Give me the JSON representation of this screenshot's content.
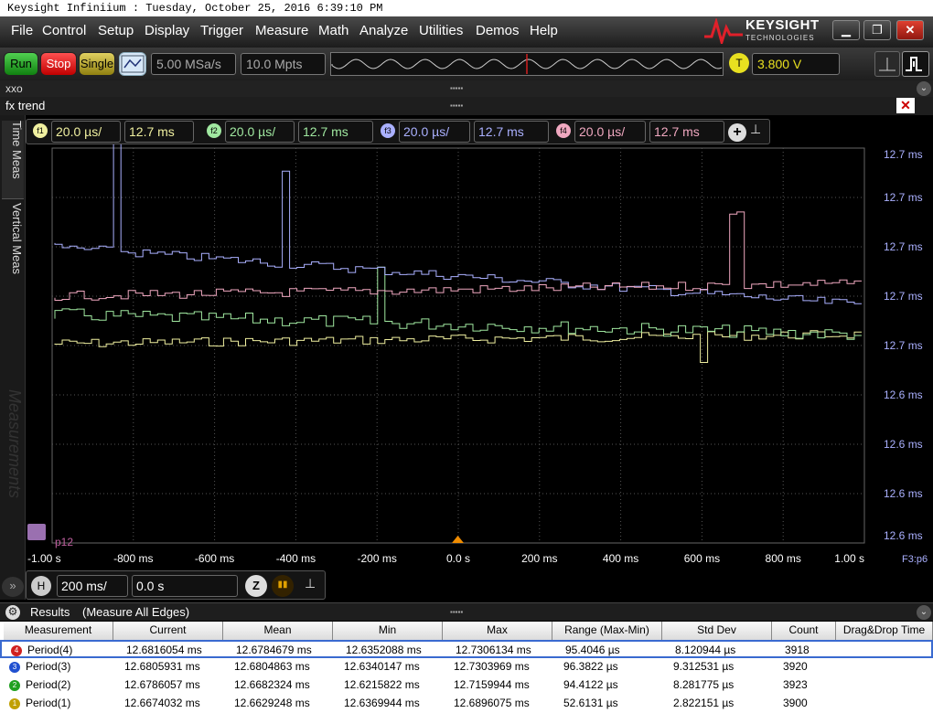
{
  "window": {
    "title": "Keysight Infiniium : Tuesday, October 25, 2016 6:39:10 PM"
  },
  "menu": [
    "File",
    "Control",
    "Setup",
    "Display",
    "Trigger",
    "Measure",
    "Math",
    "Analyze",
    "Utilities",
    "Demos",
    "Help"
  ],
  "brand": {
    "name": "KEYSIGHT",
    "sub": "TECHNOLOGIES"
  },
  "toolbar": {
    "run": "Run",
    "stop": "Stop",
    "single": "Single",
    "sample_rate": "5.00 MSa/s",
    "memory_depth": "10.0 Mpts",
    "trigger_badge": "T",
    "trigger_level": "3.800 V"
  },
  "panels": {
    "xxo": "xxo",
    "fx_trend": "fx trend",
    "handle": "▪▪▪▪▪"
  },
  "side_tabs": {
    "time_meas": "Time Meas",
    "vertical_meas": "Vertical Meas",
    "measurements": "Measurements"
  },
  "functions": [
    {
      "badge": "f1",
      "scale": "20.0 µs/",
      "offset": "12.7 ms",
      "color": "#f0f0a0"
    },
    {
      "badge": "f2",
      "scale": "20.0 µs/",
      "offset": "12.7 ms",
      "color": "#a0e8a0"
    },
    {
      "badge": "f3",
      "scale": "20.0 µs/",
      "offset": "12.7 ms",
      "color": "#aab0ff"
    },
    {
      "badge": "f4",
      "scale": "20.0 µs/",
      "offset": "12.7 ms",
      "color": "#f0a8c0"
    }
  ],
  "plot": {
    "y_tick_labels": [
      "12.7 ms",
      "12.7 ms",
      "12.7 ms",
      "12.7 ms",
      "12.7 ms",
      "12.6 ms",
      "12.6 ms",
      "12.6 ms",
      "12.6 ms"
    ],
    "x_tick_labels": [
      "-1.00 s",
      "-800 ms",
      "-600 ms",
      "-400 ms",
      "-200 ms",
      "0.0 s",
      "200 ms",
      "400 ms",
      "600 ms",
      "800 ms",
      "1.00 s"
    ],
    "corner_label": "F3:p6",
    "marker_label": "p12",
    "x_range": [
      -1.0,
      1.0
    ]
  },
  "horizontal": {
    "badge": "H",
    "scale": "200 ms/",
    "position": "0.0 s"
  },
  "results": {
    "title": "Results",
    "mode": "(Measure All Edges)",
    "columns": [
      "Measurement",
      "Current",
      "Mean",
      "Min",
      "Max",
      "Range (Max-Min)",
      "Std Dev",
      "Count",
      "Drag&Drop Time"
    ],
    "rows": [
      {
        "badge": "4",
        "color": "#d02020",
        "cells": [
          "Period(4)",
          "12.6816054 ms",
          "12.6784679 ms",
          "12.6352088 ms",
          "12.7306134 ms",
          "95.4046 µs",
          "8.120944 µs",
          "3918"
        ]
      },
      {
        "badge": "3",
        "color": "#2050d0",
        "cells": [
          "Period(3)",
          "12.6805931 ms",
          "12.6804863 ms",
          "12.6340147 ms",
          "12.7303969 ms",
          "96.3822 µs",
          "9.312531 µs",
          "3920"
        ]
      },
      {
        "badge": "2",
        "color": "#20a020",
        "cells": [
          "Period(2)",
          "12.6786057 ms",
          "12.6682324 ms",
          "12.6215822 ms",
          "12.7159944 ms",
          "94.4122 µs",
          "8.281775 µs",
          "3923"
        ]
      },
      {
        "badge": "1",
        "color": "#c0a000",
        "cells": [
          "Period(1)",
          "12.6674032 ms",
          "12.6629248 ms",
          "12.6369944 ms",
          "12.6896075 ms",
          "52.6131 µs",
          "2.822151 µs",
          "3900"
        ]
      }
    ]
  }
}
